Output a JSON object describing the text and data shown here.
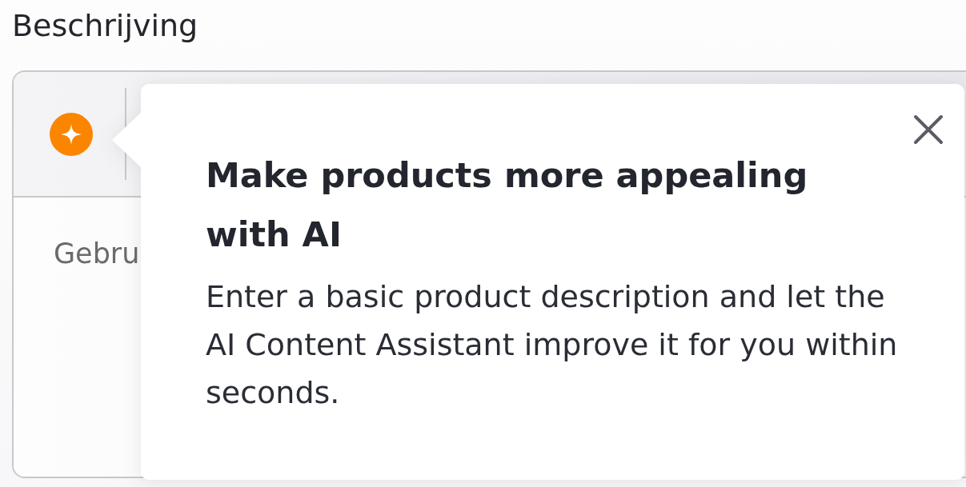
{
  "field_label": "Beschrijving",
  "editor": {
    "placeholder": "Gebru"
  },
  "popover": {
    "title": "Make products more appealing with AI",
    "text": "Enter a basic product description and let the AI Content Assistant improve it for you within seconds."
  }
}
